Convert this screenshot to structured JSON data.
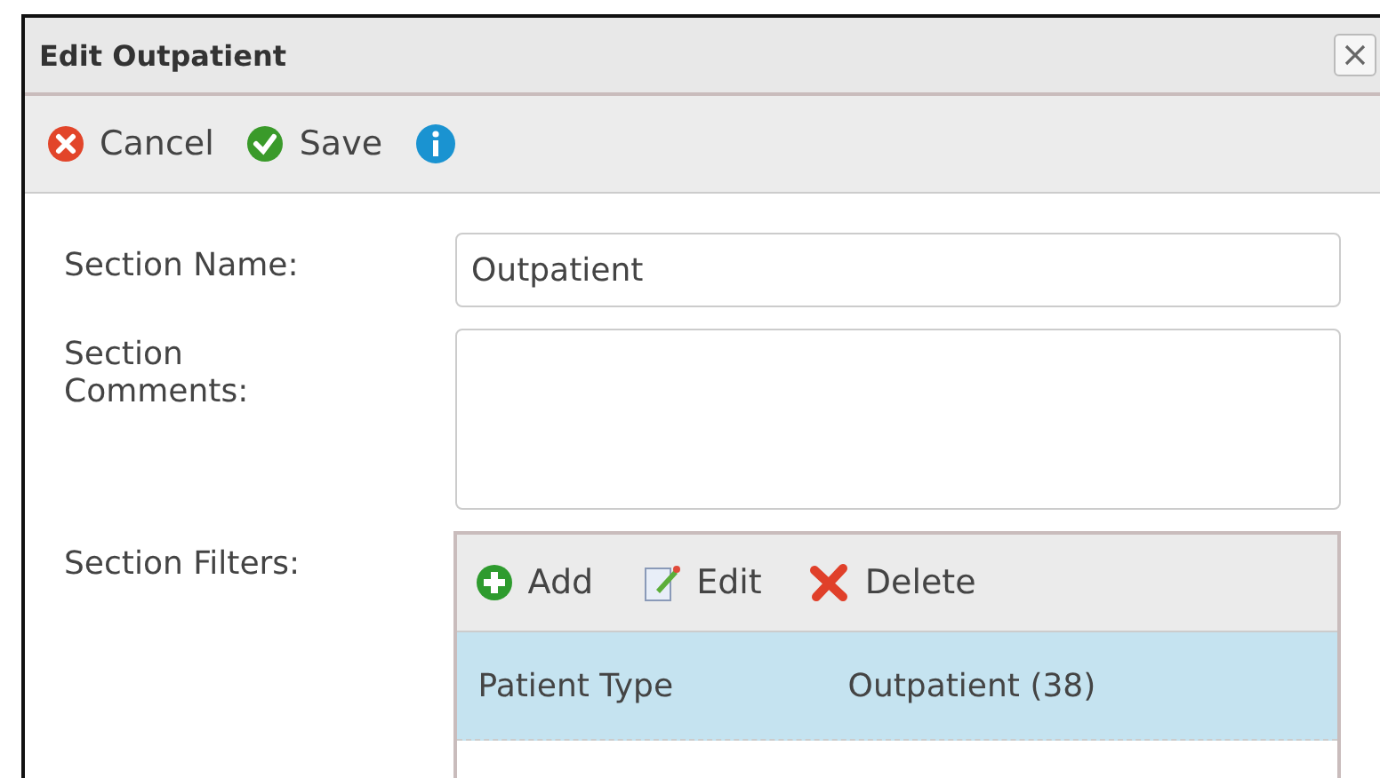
{
  "window": {
    "title": "Edit Outpatient"
  },
  "toolbar": [
    {
      "kind": "cancel",
      "label": "Cancel"
    },
    {
      "kind": "save",
      "label": "Save"
    },
    {
      "kind": "info"
    }
  ],
  "form": {
    "section_name": {
      "label": "Section Name:",
      "value": "Outpatient"
    },
    "section_comments": {
      "label": "Section Comments:"
    },
    "section_filters": {
      "label": "Section Filters:",
      "actions": [
        {
          "kind": "add",
          "label": "Add"
        },
        {
          "kind": "edit",
          "label": "Edit"
        },
        {
          "kind": "delete",
          "label": "Delete"
        }
      ],
      "rows": [
        {
          "field": "Patient Type",
          "value": "Outpatient (38)",
          "selected": true
        }
      ]
    }
  }
}
